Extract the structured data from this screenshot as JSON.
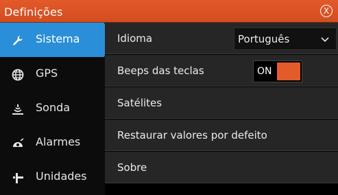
{
  "window": {
    "title": "Definições",
    "close_symbol": "X"
  },
  "colors": {
    "titlebar": "#e25a2a",
    "selected": "#2a8fd8",
    "toggle_on": "#e35b2a"
  },
  "sidebar": {
    "items": [
      {
        "label": "Sistema",
        "icon": "wrench-icon",
        "selected": true
      },
      {
        "label": "GPS",
        "icon": "globe-icon"
      },
      {
        "label": "Sonda",
        "icon": "sonar-icon"
      },
      {
        "label": "Alarmes",
        "icon": "alarm-icon"
      },
      {
        "label": "Unidades",
        "icon": "units-icon"
      }
    ]
  },
  "settings": {
    "language": {
      "label": "Idioma",
      "value": "Português"
    },
    "key_beeps": {
      "label": "Beeps das teclas",
      "state": "ON"
    },
    "satellites": {
      "label": "Satélites"
    },
    "restore": {
      "label": "Restaurar valores por defeito"
    },
    "about": {
      "label": "Sobre"
    }
  }
}
